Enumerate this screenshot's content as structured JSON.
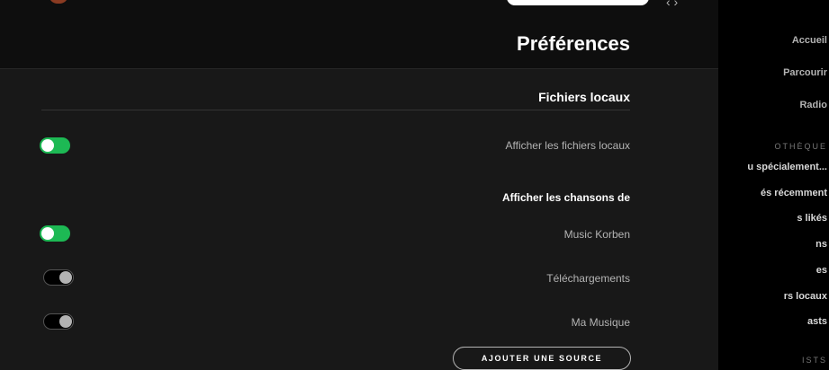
{
  "header": {
    "title": "Préférences",
    "user_name": "",
    "nav_chevrons": "‹ ›"
  },
  "local_files": {
    "section_title": "Fichiers locaux",
    "show_local_files_label": "Afficher les fichiers locaux",
    "show_local_files_on": true,
    "show_songs_from_title": "Afficher les chansons de",
    "sources": [
      {
        "label": "Music Korben",
        "enabled": true
      },
      {
        "label": "Téléchargements",
        "enabled": false
      },
      {
        "label": "Ma Musique",
        "enabled": false
      }
    ],
    "add_source_label": "AJOUTER UNE SOURCE"
  },
  "sidebar": {
    "nav": [
      {
        "label": "Accueil"
      },
      {
        "label": "Parcourir"
      },
      {
        "label": "Radio"
      }
    ],
    "library_heading": "OTHÈQUE",
    "library_items": [
      {
        "label": "u spécialement..."
      },
      {
        "label": "és récemment"
      },
      {
        "label": "s likés"
      },
      {
        "label": "ns"
      },
      {
        "label": "es"
      },
      {
        "label": "rs locaux"
      },
      {
        "label": "asts"
      }
    ],
    "playlists_heading": "ISTS"
  },
  "colors": {
    "accent": "#1db954",
    "background": "#181818",
    "sidebar": "#000000"
  }
}
